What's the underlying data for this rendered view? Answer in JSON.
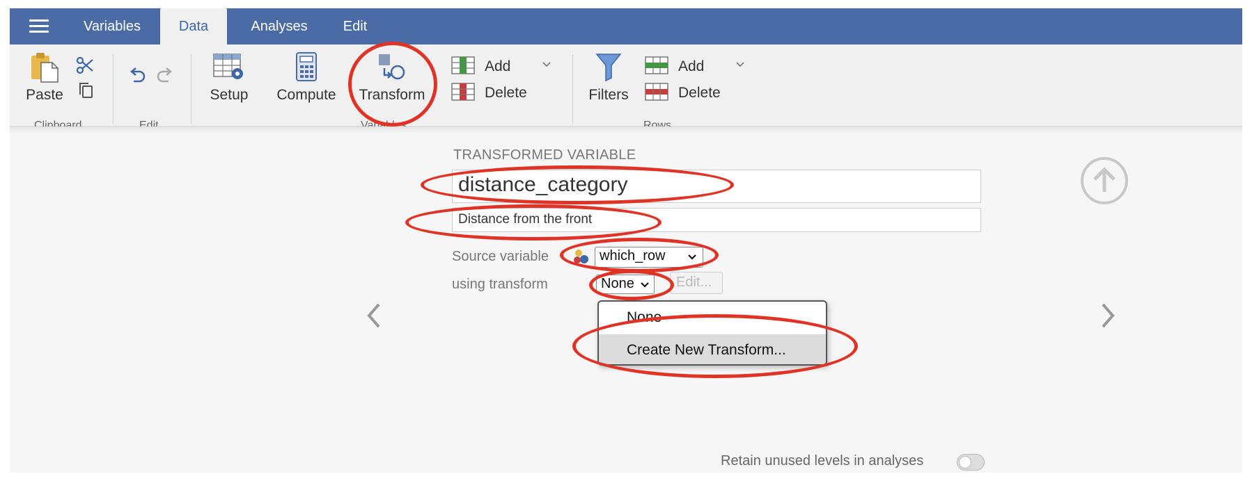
{
  "menubar": {
    "tabs": [
      {
        "label": "Variables"
      },
      {
        "label": "Data"
      },
      {
        "label": "Analyses"
      },
      {
        "label": "Edit"
      }
    ],
    "active_tab": "Data"
  },
  "ribbon": {
    "clipboard": {
      "paste": "Paste",
      "group": "Clipboard"
    },
    "edit": {
      "group": "Edit"
    },
    "variables": {
      "setup": "Setup",
      "compute": "Compute",
      "transform": "Transform",
      "add": "Add",
      "delete": "Delete",
      "group": "Variables"
    },
    "filters": "Filters",
    "rows": {
      "add": "Add",
      "delete": "Delete",
      "group": "Rows"
    }
  },
  "editor": {
    "section_title": "TRANSFORMED VARIABLE",
    "variable_name": "distance_category",
    "description": "Distance from the front",
    "source_label": "Source variable",
    "source_value": "which_row",
    "transform_label": "using transform",
    "transform_value": "None",
    "edit_button": "Edit...",
    "dropdown_options": [
      "None",
      "Create New Transform..."
    ],
    "retain_label": "Retain unused levels in analyses",
    "retain_enabled": false
  },
  "colors": {
    "menubar": "#4a6ba5",
    "accent": "#3e67a5",
    "annotation_red": "#e03326"
  }
}
